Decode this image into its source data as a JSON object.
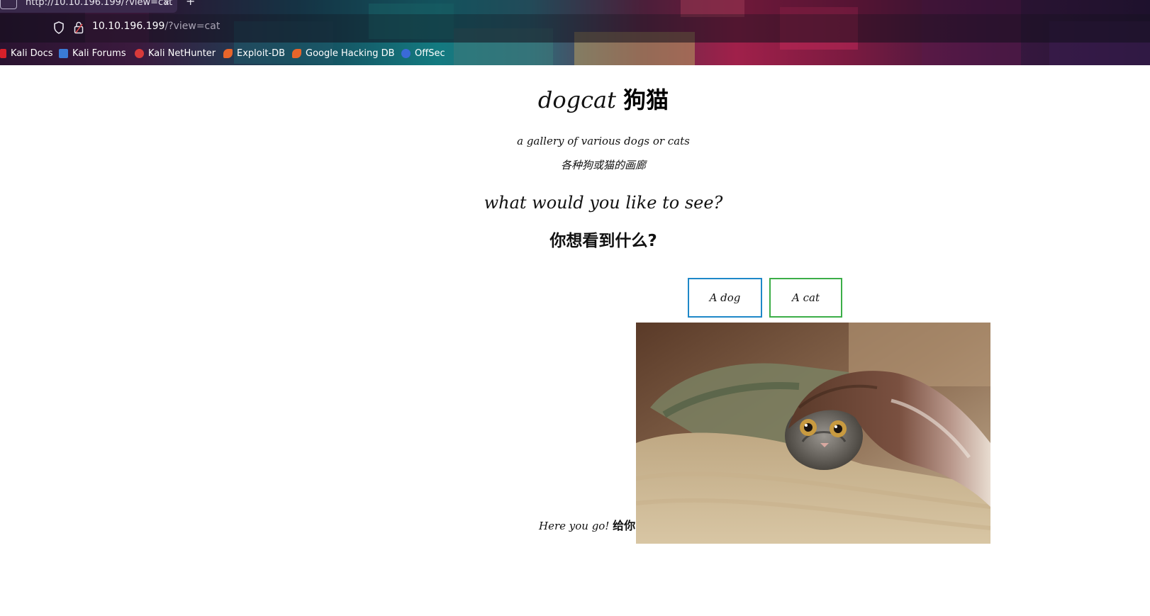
{
  "browser": {
    "tab": {
      "title": "http://10.10.196.199/?view=cat",
      "close_glyph": "×",
      "new_tab_glyph": "+"
    },
    "address_bar": {
      "host": "10.10.196.199",
      "path": "/?view=cat",
      "security_icon": "shield-icon",
      "lock_icon": "lock-icon"
    },
    "bookmarks": [
      {
        "label": "Kali Docs",
        "icon": "kali-docs-icon",
        "color": "#d8202a"
      },
      {
        "label": "Kali Forums",
        "icon": "kali-forums-icon",
        "color": "#3a7bd5"
      },
      {
        "label": "Kali NetHunter",
        "icon": "kali-nethunter-icon",
        "color": "#d83a3a"
      },
      {
        "label": "Exploit-DB",
        "icon": "exploit-db-icon",
        "color": "#e8652a"
      },
      {
        "label": "Google Hacking DB",
        "icon": "ghdb-icon",
        "color": "#e8652a"
      },
      {
        "label": "OffSec",
        "icon": "offsec-icon",
        "color": "#3a6ad8"
      }
    ]
  },
  "page": {
    "title_en": "dogcat",
    "title_zh": "狗猫",
    "subtitle_en": "a gallery of various dogs or cats",
    "subtitle_zh": "各种狗或猫的画廊",
    "question_en": "what would you like to see?",
    "question_zh": "你想看到什么?",
    "dog_button_label": "A dog",
    "cat_button_label": "A cat",
    "dog_button_color": "#1e88c8",
    "cat_button_color": "#3cae48",
    "caption_en": "Here you go!",
    "caption_zh": "给你!",
    "image_subject": "cat-under-blanket-photo"
  }
}
